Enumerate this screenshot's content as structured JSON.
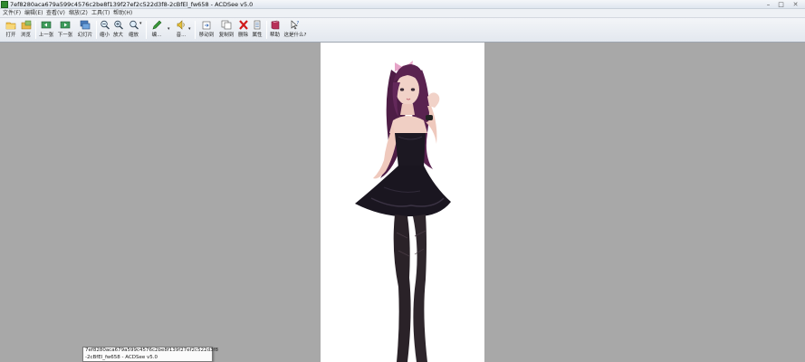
{
  "window": {
    "title": "7ef8280aca679a599c4576c2be8f139f27ef2c522d3f8-2cBfEl_fw658 - ACDSee v5.0",
    "controls": {
      "minimize": "–",
      "maximize": "□",
      "close": "✕"
    }
  },
  "menu": {
    "items": [
      "文件(F)",
      "编辑(E)",
      "查看(V)",
      "缩放(Z)",
      "工具(T)",
      "帮助(H)"
    ]
  },
  "toolbar": {
    "buttons": [
      {
        "label": "打开",
        "icon": "open-folder-icon"
      },
      {
        "label": "浏览",
        "icon": "browse-icon"
      },
      {
        "label": "上一张",
        "icon": "previous-image-icon"
      },
      {
        "label": "下一张",
        "icon": "next-image-icon"
      },
      {
        "label": "幻灯片",
        "icon": "slideshow-icon"
      },
      {
        "label": "缩小",
        "icon": "zoom-out-icon"
      },
      {
        "label": "放大",
        "icon": "zoom-in-icon"
      },
      {
        "label": "缩放",
        "icon": "zoom-icon"
      },
      {
        "label": "编...",
        "icon": "edit-icon"
      },
      {
        "label": "音...",
        "icon": "audio-icon"
      },
      {
        "label": "移动到",
        "icon": "move-to-icon"
      },
      {
        "label": "复制到",
        "icon": "copy-to-icon"
      },
      {
        "label": "删除",
        "icon": "delete-icon"
      },
      {
        "label": "属性",
        "icon": "properties-icon"
      },
      {
        "label": "帮助",
        "icon": "help-book-icon"
      },
      {
        "label": "这是什么?",
        "icon": "whats-this-icon"
      }
    ]
  },
  "tooltip": {
    "line1": "7ef8280aca679a599c4576c2be8f139f27ef2c522d3f8",
    "line2": "-2cBfEl_fw658 - ACDSee v5.0"
  },
  "colors": {
    "background": "#a8a8a8",
    "canvas": "#ffffff",
    "hair": "#5a2350",
    "dress": "#1c1822",
    "skin": "#f0cfc4"
  }
}
